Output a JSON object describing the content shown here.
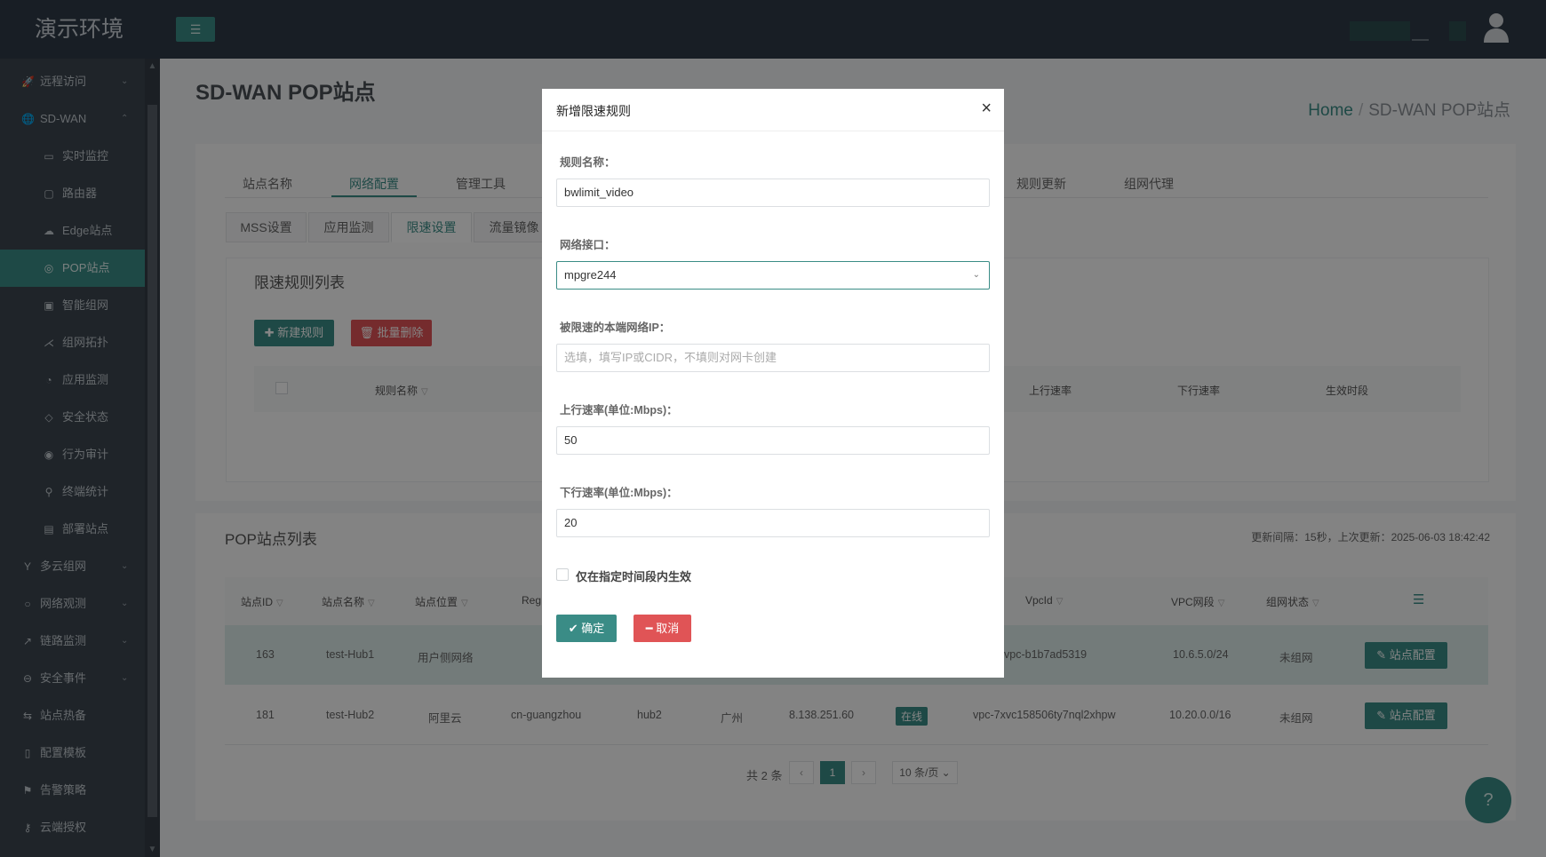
{
  "app": {
    "brand": "演示环境",
    "menu_icon": "☰"
  },
  "sidebar": {
    "items": [
      {
        "icon": "🚀",
        "label": "远程访问",
        "chevron": "⌄"
      },
      {
        "icon": "🌐",
        "label": "SD-WAN",
        "chevron": "⌃"
      },
      {
        "icon": "▭",
        "label": "实时监控"
      },
      {
        "icon": "▢",
        "label": "路由器"
      },
      {
        "icon": "☁",
        "label": "Edge站点"
      },
      {
        "icon": "◎",
        "label": "POP站点"
      },
      {
        "icon": "▣",
        "label": "智能组网"
      },
      {
        "icon": "⋌",
        "label": "组网拓扑"
      },
      {
        "icon": "◔",
        "label": "应用监测"
      },
      {
        "icon": "◇",
        "label": "安全状态"
      },
      {
        "icon": "◉",
        "label": "行为审计"
      },
      {
        "icon": "⚲",
        "label": "终端统计"
      },
      {
        "icon": "▤",
        "label": "部署站点"
      },
      {
        "icon": "Y",
        "label": "多云组网",
        "chevron": "⌄"
      },
      {
        "icon": "○",
        "label": "网络观测",
        "chevron": "⌄"
      },
      {
        "icon": "↗",
        "label": "链路监测",
        "chevron": "⌄"
      },
      {
        "icon": "⊖",
        "label": "安全事件",
        "chevron": "⌄"
      },
      {
        "icon": "⇆",
        "label": "站点热备"
      },
      {
        "icon": "▯",
        "label": "配置模板"
      },
      {
        "icon": "⚑",
        "label": "告警策略"
      },
      {
        "icon": "⚷",
        "label": "云端授权"
      }
    ]
  },
  "header": {
    "title": "SD-WAN POP站点",
    "breadcrumb_home": "Home",
    "breadcrumb_sep": "/",
    "breadcrumb_current": "SD-WAN POP站点"
  },
  "tabs": [
    {
      "label": "站点名称"
    },
    {
      "label": "网络配置"
    },
    {
      "label": "管理工具"
    },
    {
      "label": "规则更新"
    },
    {
      "label": "组网代理"
    }
  ],
  "subtabs": [
    {
      "label": "MSS设置"
    },
    {
      "label": "应用监测"
    },
    {
      "label": "限速设置"
    },
    {
      "label": "流量镜像"
    }
  ],
  "rate_rules": {
    "title": "限速规则列表",
    "new_btn": "✚ 新建规则",
    "delete_btn": "🗑 批量删除",
    "columns": {
      "name": "规则名称",
      "up": "上行速率",
      "down": "下行速率",
      "time": "生效时段"
    }
  },
  "pop_list": {
    "title": "POP站点列表",
    "refresh_info": "更新间隔：15秒，上次更新：2025-06-03 18:42:42",
    "columns": {
      "id": "站点ID",
      "name": "站点名称",
      "loc": "站点位置",
      "region": "Reg",
      "vpcid": "VpcId",
      "vpc_cidr": "VPC网段",
      "status": "组网状态"
    },
    "rows": [
      {
        "id": "163",
        "name": "test-Hub1",
        "loc": "用户侧网络",
        "region": "",
        "hub": "",
        "city": "",
        "ip": "",
        "online": "",
        "vpcid": "vpc-b1b7ad5319",
        "cidr": "10.6.5.0/24",
        "status": "未组网",
        "action": "站点配置"
      },
      {
        "id": "181",
        "name": "test-Hub2",
        "loc": "阿里云",
        "region": "cn-guangzhou",
        "hub": "hub2",
        "city": "广州",
        "ip": "8.138.251.60",
        "online": "在线",
        "vpcid": "vpc-7xvc158506ty7nql2xhpw",
        "cidr": "10.20.0.0/16",
        "status": "未组网",
        "action": "站点配置"
      }
    ],
    "pager": {
      "total": "共 2 条",
      "prev": "‹",
      "page": "1",
      "next": "›",
      "size": "10 条/页 ⌄"
    }
  },
  "help": "?",
  "modal": {
    "title": "新增限速规则",
    "close": "×",
    "name_label": "规则名称：",
    "name_value": "bwlimit_video",
    "iface_label": "网络接口：",
    "iface_value": "mpgre244",
    "iface_arrow": "⌄",
    "ip_label": "被限速的本端网络IP：",
    "ip_placeholder": "选填，填写IP或CIDR，不填则对网卡创建",
    "up_label": "上行速率(单位:Mbps)：",
    "up_value": "50",
    "down_label": "下行速率(单位:Mbps)：",
    "down_value": "20",
    "time_only_label": "仅在指定时间段内生效",
    "confirm": "✔ 确定",
    "cancel": "━ 取消"
  },
  "colors": {
    "accent": "#3a8c86",
    "danger": "#e05456",
    "topbar": "#2f3b47",
    "sidebar": "#3c4650"
  }
}
